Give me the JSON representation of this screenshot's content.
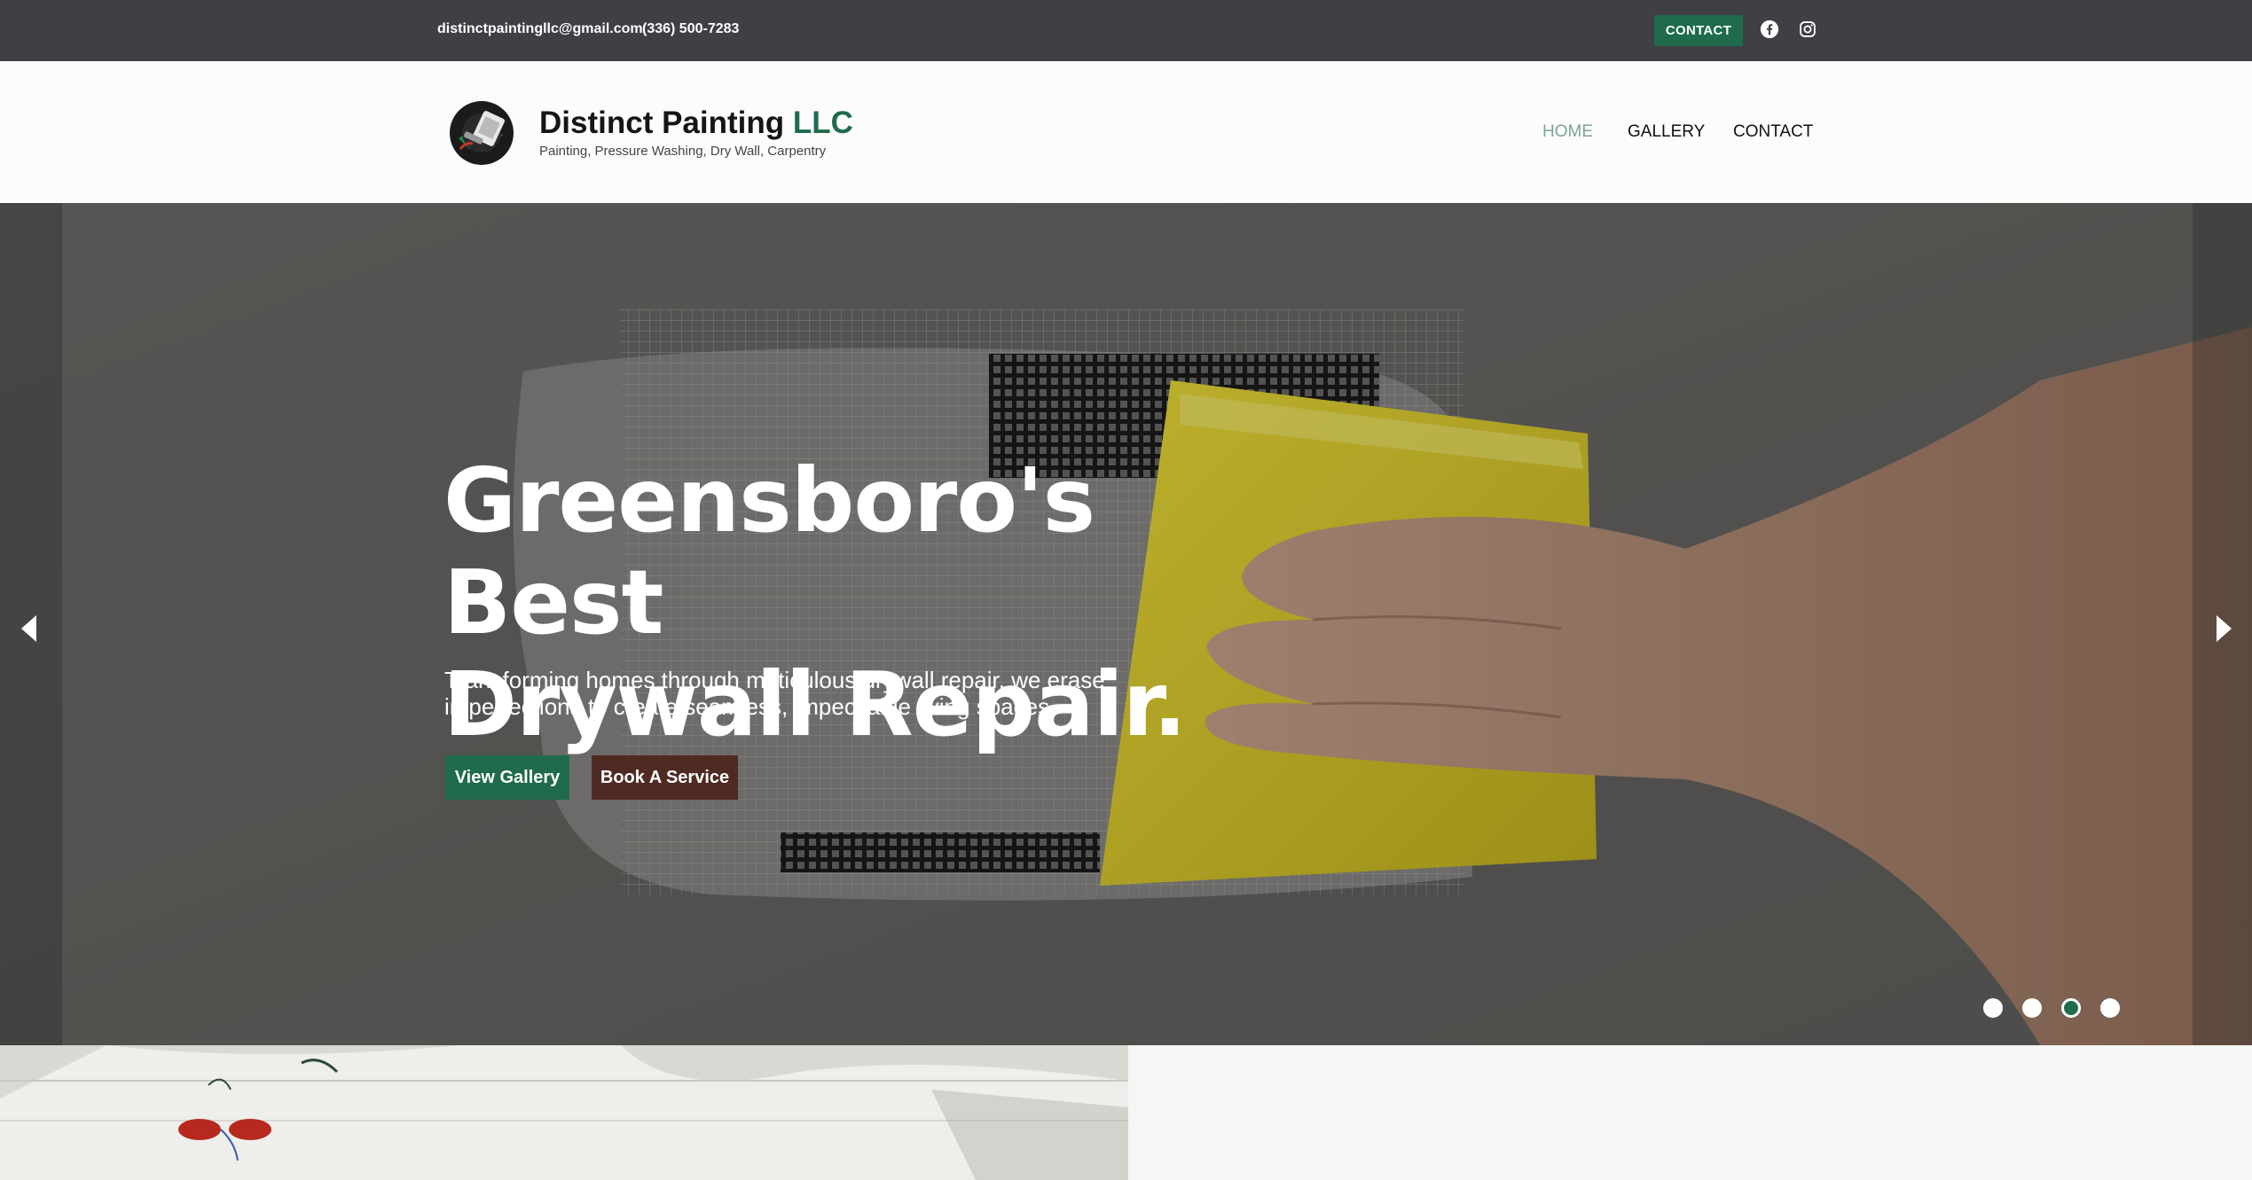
{
  "topbar": {
    "email": "distinctpaintingllc@gmail.com",
    "phone": "(336) 500-7283",
    "contact_label": "CONTACT",
    "social_icons": [
      "facebook-icon",
      "instagram-icon"
    ]
  },
  "header": {
    "brand_name": "Distinct Painting ",
    "brand_suffix": "LLC",
    "tagline": "Painting, Pressure Washing, Dry Wall, Carpentry",
    "nav": {
      "home": "HOME",
      "gallery": "GALLERY",
      "contact": "CONTACT"
    }
  },
  "hero": {
    "title_line1": "Greensboro's Best",
    "title_line2": "Drywall Repair.",
    "subtitle": "Transforming homes through meticulous drywall repair, we erase imperfections to create seamless, impeccable living spaces.",
    "primary_button": "View Gallery",
    "secondary_button": "Book A Service",
    "slide_count": 4,
    "active_slide": 3
  },
  "colors": {
    "accent": "#1f6b4c",
    "topbar_bg": "#3f3f46",
    "book_button": "#4e2a22",
    "nav_active": "#7ba596"
  }
}
